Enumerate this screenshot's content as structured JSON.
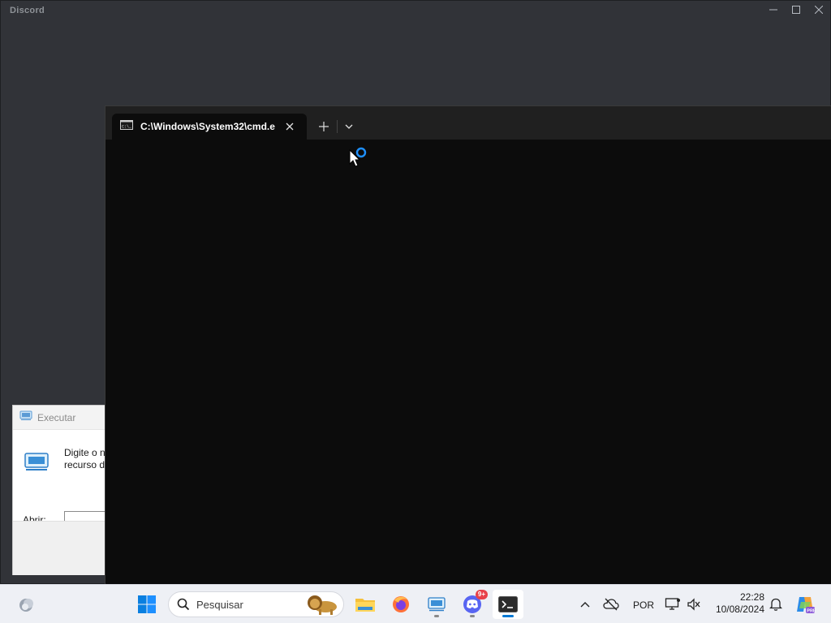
{
  "discord": {
    "title": "Discord"
  },
  "terminal": {
    "tab_title": "C:\\Windows\\System32\\cmd.e"
  },
  "run_dialog": {
    "title": "Executar",
    "description_line1": "Digite o n",
    "description_line2": "recurso d",
    "open_label": "Abrir:",
    "open_value": ""
  },
  "taskbar": {
    "search_placeholder": "Pesquisar",
    "discord_badge": "9+",
    "language": "POR",
    "time": "22:28",
    "date": "10/08/2024"
  },
  "icons": {
    "start": "windows-start-icon",
    "search": "search-icon",
    "explorer": "file-explorer-icon",
    "firefox": "firefox-icon",
    "run": "run-icon",
    "discord": "discord-icon",
    "terminal": "terminal-icon"
  },
  "colors": {
    "discord_bg": "#313338",
    "terminal_bg": "#0c0c0c",
    "tabbar_bg": "#202020",
    "taskbar_bg": "#eef0f5",
    "accent": "#0078d4"
  }
}
